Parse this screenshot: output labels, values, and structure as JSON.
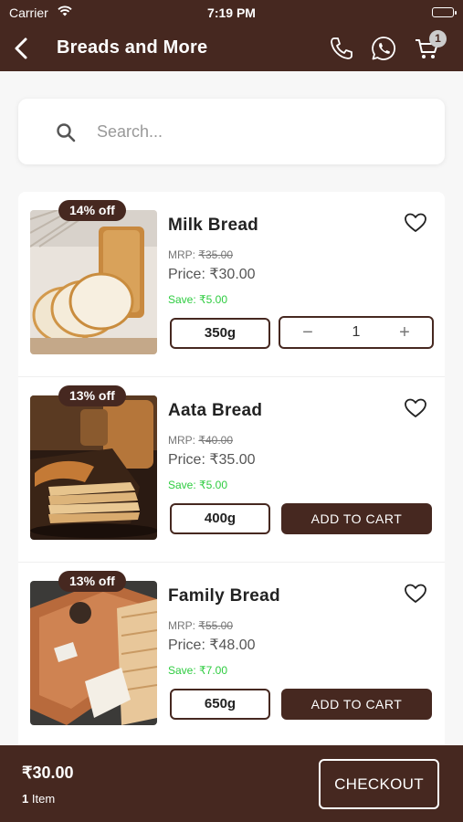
{
  "status_bar": {
    "carrier": "Carrier",
    "time": "7:19 PM"
  },
  "header": {
    "title": "Breads and More",
    "cart_count": "1",
    "icons": [
      "back-icon",
      "phone-icon",
      "whatsapp-icon",
      "cart-icon"
    ]
  },
  "search": {
    "placeholder": "Search...",
    "value": ""
  },
  "products": [
    {
      "discount": "14% off",
      "name": "Milk Bread",
      "mrp_label": "MRP:",
      "mrp": "₹35.00",
      "price": "Price: ₹30.00",
      "save": "Save: ₹5.00",
      "weight": "350g",
      "quantity": "1",
      "in_cart": true
    },
    {
      "discount": "13% off",
      "name": "Aata Bread",
      "mrp_label": "MRP:",
      "mrp": "₹40.00",
      "price": "Price: ₹35.00",
      "save": "Save: ₹5.00",
      "weight": "400g",
      "add_label": "ADD TO CART",
      "in_cart": false
    },
    {
      "discount": "13% off",
      "name": "Family Bread",
      "mrp_label": "MRP:",
      "mrp": "₹55.00",
      "price": "Price: ₹48.00",
      "save": "Save: ₹7.00",
      "weight": "650g",
      "add_label": "ADD TO CART",
      "in_cart": false
    }
  ],
  "stepper": {
    "minus": "−",
    "plus": "+"
  },
  "footer": {
    "total": "₹30.00",
    "item_count": "1",
    "item_label": "Item",
    "checkout_label": "CHECKOUT"
  },
  "colors": {
    "brand": "#462820",
    "save_green": "#2ecc40",
    "background": "#f7f7f7"
  }
}
